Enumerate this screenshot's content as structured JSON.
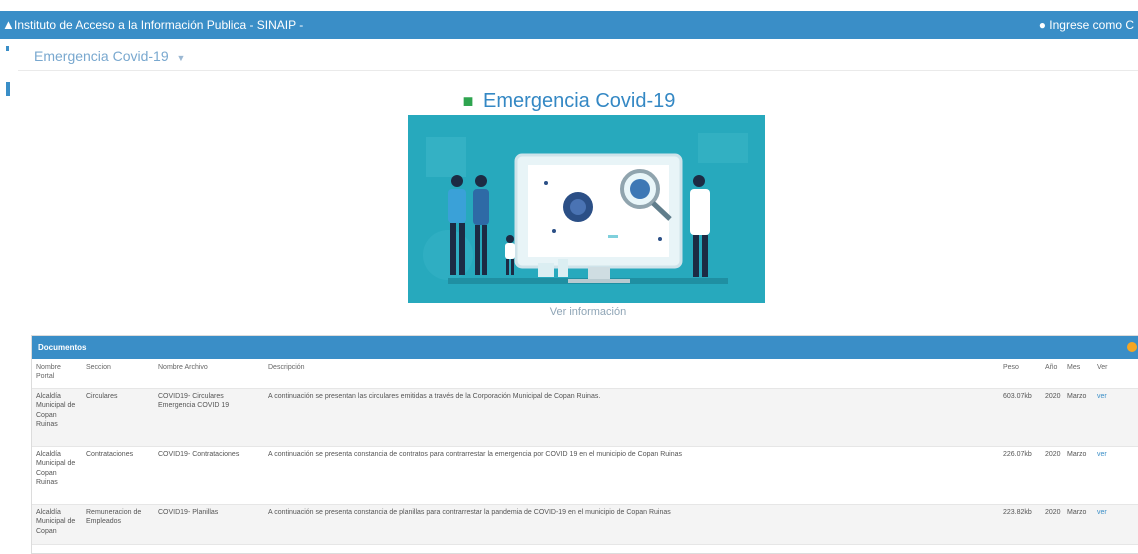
{
  "header": {
    "title": "Instituto de Acceso a la Información Publica - SINAIP -",
    "login_label": "Ingrese como C"
  },
  "breadcrumb": {
    "label": "Emergencia Covid-19"
  },
  "hero": {
    "title": "Emergencia Covid-19",
    "link_label": "Ver información"
  },
  "documents": {
    "panel_title": "Documentos",
    "columns": [
      "Nombre Portal",
      "Seccion",
      "Nombre Archivo",
      "Descripción",
      "Peso",
      "Año",
      "Mes",
      "Ver"
    ],
    "rows": [
      {
        "portal": "Alcaldía Municipal de Copan Ruinas",
        "seccion": "Circulares",
        "archivo": "COVID19- Circulares Emergencia COVID 19",
        "descripcion": "A continuación se presentan las circulares emitidas a través de la Corporación Municipal de Copan Ruinas.",
        "peso": "603.07kb",
        "anio": "2020",
        "mes": "Marzo",
        "ver": "ver"
      },
      {
        "portal": "Alcaldía Municipal de Copan Ruinas",
        "seccion": "Contrataciones",
        "archivo": "COVID19- Contrataciones",
        "descripcion": "A continuación se presenta constancia de contratos para contrarrestar la emergencia por COVID 19 en el municipio de Copan Ruinas",
        "peso": "226.07kb",
        "anio": "2020",
        "mes": "Marzo",
        "ver": "ver"
      },
      {
        "portal": "Alcaldía Municipal de Copan",
        "seccion": "Remuneracion de Empleados",
        "archivo": "COVID19- Planillas",
        "descripcion": "A continuación se presenta constancia de planillas para contrarrestar la pandemia de COVID-19 en el municipio de Copan Ruinas",
        "peso": "223.82kb",
        "anio": "2020",
        "mes": "Marzo",
        "ver": "ver"
      }
    ]
  },
  "icons": {
    "header_logo": "user-icon",
    "login": "user-icon",
    "hero_title": "truck-icon",
    "panel_action": "circle-badge-icon"
  },
  "colors": {
    "brand_blue": "#3a8ec7",
    "hero_teal": "#27a9bd",
    "icon_green": "#2ea44f",
    "badge_orange": "#f5a623"
  }
}
